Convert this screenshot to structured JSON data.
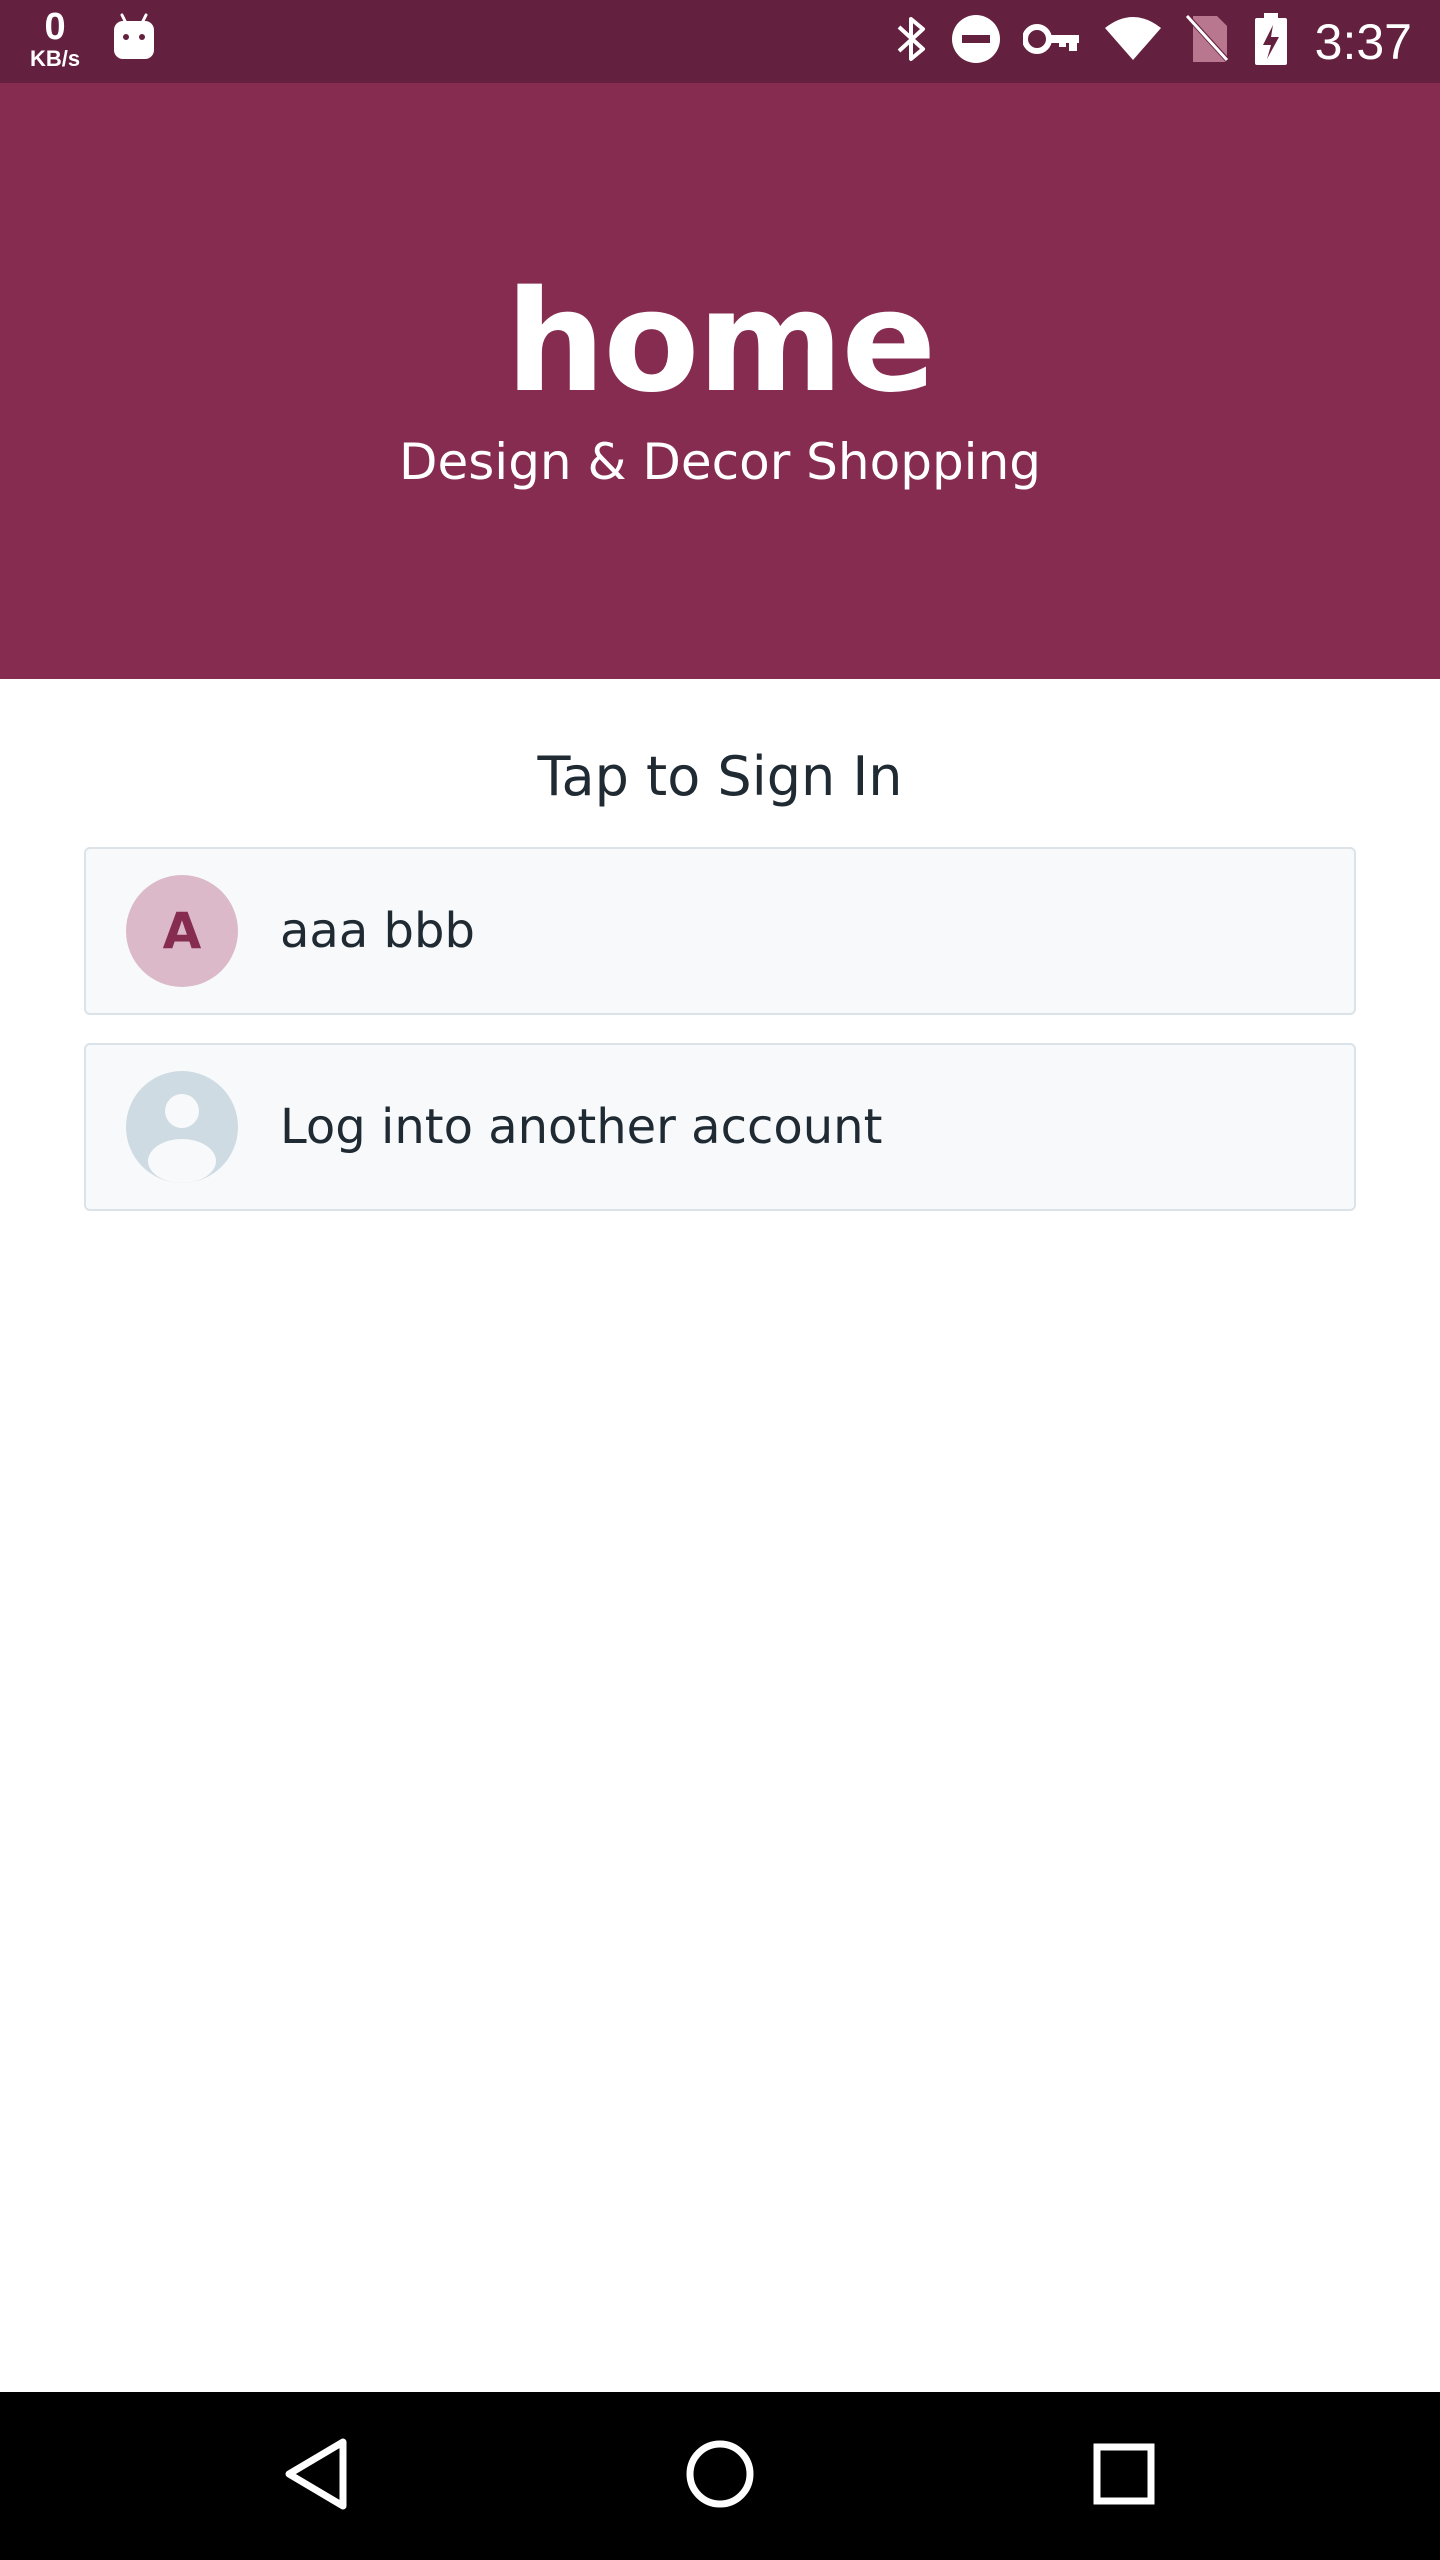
{
  "status_bar": {
    "net_speed_value": "0",
    "net_speed_unit": "KB/s",
    "time": "3:37",
    "icons": [
      "android-icon",
      "bluetooth-icon",
      "do-not-disturb-icon",
      "vpn-key-icon",
      "wifi-icon",
      "no-sim-icon",
      "battery-charging-icon"
    ]
  },
  "header": {
    "logo": "home",
    "tagline": "Design & Decor Shopping",
    "color": "#872c51"
  },
  "main": {
    "title": "Tap to Sign In",
    "accounts": [
      {
        "initial": "A",
        "name": "aaa bbb"
      }
    ],
    "other_account_label": "Log into another account"
  },
  "nav_bar": {
    "icons": [
      "back-icon",
      "home-icon",
      "recents-icon"
    ]
  }
}
